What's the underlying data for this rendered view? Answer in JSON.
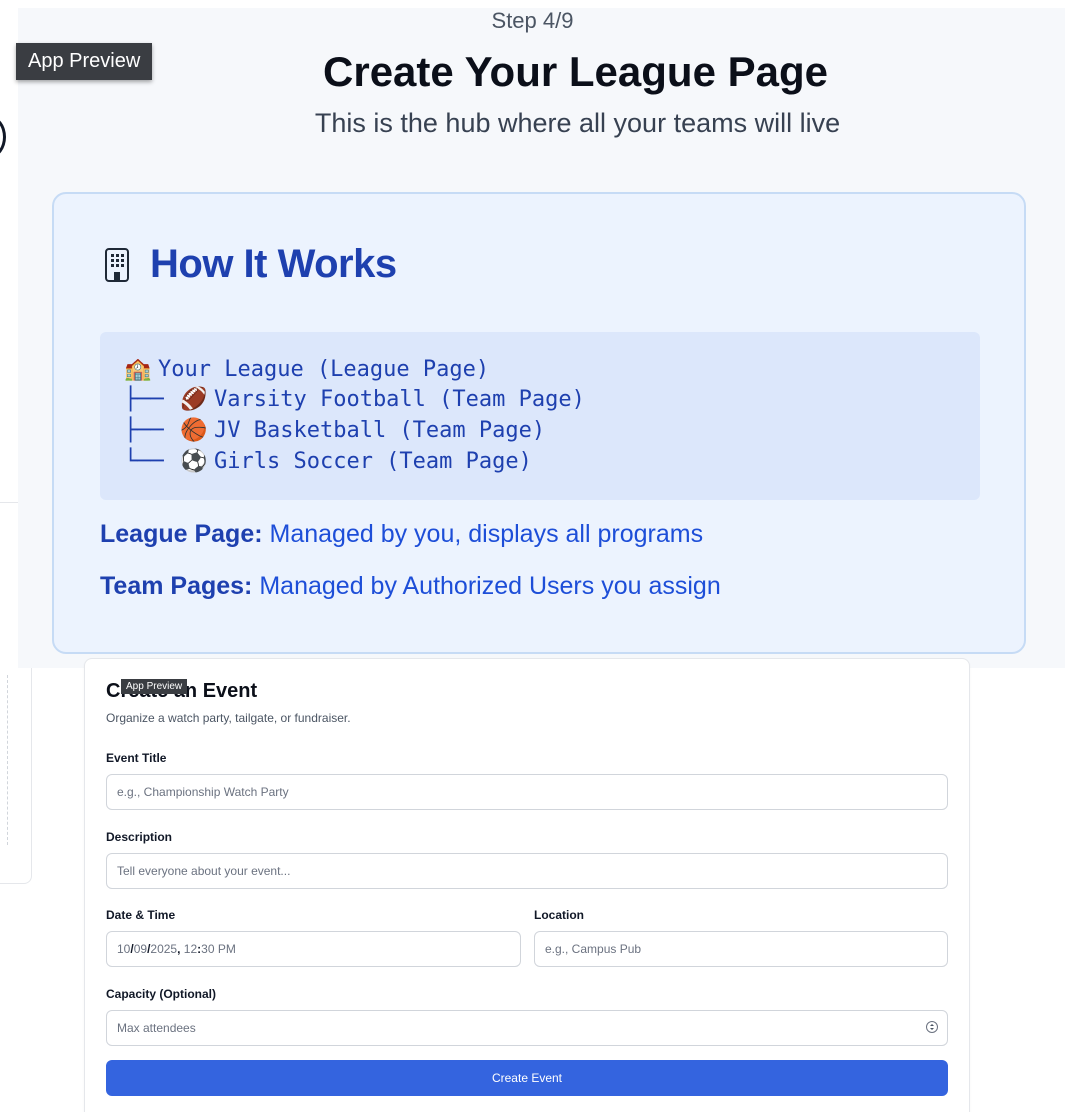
{
  "onboarding": {
    "step": "Step 4/9",
    "title": "Create Your League Page",
    "subtitle": "This is the hub where all your teams will live",
    "app_preview_label": "App Preview",
    "how_it_works": {
      "icon": "building-icon",
      "title": "How It Works",
      "tree": [
        {
          "connector": "",
          "emoji": "🏫",
          "text": "Your League (League Page)"
        },
        {
          "connector": "├──",
          "emoji": "🏈",
          "text": "Varsity Football (Team Page)"
        },
        {
          "connector": "├──",
          "emoji": "🏀",
          "text": "JV Basketball (Team Page)"
        },
        {
          "connector": "└──",
          "emoji": "⚽",
          "text": "Girls Soccer (Team Page)"
        }
      ],
      "league_page_label": "League Page:",
      "league_page_text": "Managed by you, displays all programs",
      "team_pages_label": "Team Pages:",
      "team_pages_text": "Managed by Authorized Users you assign"
    }
  },
  "event_form": {
    "app_preview_label": "App Preview",
    "title": "Create an Event",
    "subtitle": "Organize a watch party, tailgate, or fundraiser.",
    "event_title": {
      "label": "Event Title",
      "placeholder": "e.g., Championship Watch Party"
    },
    "description": {
      "label": "Description",
      "placeholder": "Tell everyone about your event..."
    },
    "date_time": {
      "label": "Date & Time",
      "month": "10",
      "day": "09",
      "year": "2025",
      "hour": "12",
      "minute": "30",
      "ampm": "PM"
    },
    "location": {
      "label": "Location",
      "placeholder": "e.g., Campus Pub"
    },
    "capacity": {
      "label": "Capacity (Optional)",
      "placeholder": "Max attendees"
    },
    "submit_label": "Create Event"
  },
  "colors": {
    "accent_blue": "#1e40af",
    "button_blue": "#3464df",
    "card_bg": "#ecf3fe",
    "tree_bg": "#dce7fb"
  }
}
